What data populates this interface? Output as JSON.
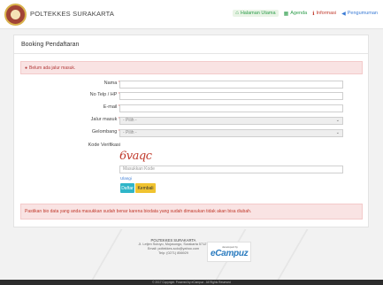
{
  "header": {
    "brand": "POLTEKKES SURAKARTA",
    "nav": [
      {
        "label": "Halaman Utama",
        "icon": "home-icon",
        "glyph": "⌂",
        "color": "#2e9d4b"
      },
      {
        "label": "Agenda",
        "icon": "calendar-icon",
        "glyph": "▦",
        "color": "#2e9d4b"
      },
      {
        "label": "Informasi",
        "icon": "info-icon",
        "glyph": "ℹ",
        "color": "#c0392b"
      },
      {
        "label": "Pengumuman",
        "icon": "megaphone-icon",
        "glyph": "◀",
        "color": "#3a7bd5"
      }
    ]
  },
  "panel": {
    "title": "Booking Pendaftaran",
    "alert_top": "Belum ada jalur masuk.",
    "alert_bottom": "Pastikan bio data yang anda masukkan sudah benar karena biodata yang sudah dimasukan tidak akan bisa diubah."
  },
  "form": {
    "nama_label": "Nama",
    "telp_label": "No Telp / HP",
    "email_label": "E-mail",
    "jalur_label": "Jalur masuk",
    "jalur_value": "- Pilih -",
    "gelombang_label": "Gelombang",
    "gelombang_value": "- Pilih -",
    "kode_label": "Kode Verifikasi",
    "required_mark": "*",
    "captcha_text": "6vaqc",
    "verify_placeholder": "Masukkan Kode",
    "reload_label": "Ulangi",
    "daftar_label": "Daftar",
    "kembali_label": "Kembali"
  },
  "footer": {
    "institution": "POLTEKKES SURAKARTA",
    "address": "Jl. Letjen Sutoyo, Mojosongo, Surakarta 57127",
    "email": "Email: poltekkes-solo@yahoo.com",
    "phone": "Telp: (0271) 856929",
    "sponsor_label": "developed by",
    "sponsor_logo": "eCampuz",
    "copyright": "© 2017 Copyright. Powered by eCampuz - All Rights Reserved"
  },
  "colors": {
    "alert_bg": "#f9e3e3",
    "alert_text": "#b23b3b",
    "btn_daftar": "#2fb5c8",
    "btn_kembali": "#f0c330"
  }
}
